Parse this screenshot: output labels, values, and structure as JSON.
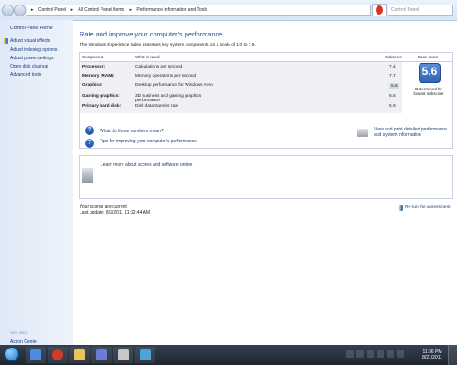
{
  "address": {
    "path": [
      "Control Panel",
      "All Control Panel Items",
      "Performance Information and Tools"
    ],
    "separator": "▸",
    "search_placeholder": "Control Panel"
  },
  "sidebar": {
    "home": "Control Panel Home",
    "links": [
      "Adjust visual effects",
      "Adjust indexing options",
      "Adjust power settings",
      "Open disk cleanup",
      "Advanced tools"
    ],
    "see_also": "See also",
    "action_center": "Action Center"
  },
  "main": {
    "title": "Rate and improve your computer's performance",
    "description": "The Windows Experience Index assesses key system components on a scale of 1.0 to 7.9.",
    "table": {
      "headers": {
        "component": "Component",
        "what": "What is rated",
        "subscore": "Subscore",
        "base": "Base score"
      },
      "rows": [
        {
          "component": "Processor:",
          "what": "Calculations per second",
          "subscore": "7.4"
        },
        {
          "component": "Memory (RAM):",
          "what": "Memory operations per second",
          "subscore": "7.7"
        },
        {
          "component": "Graphics:",
          "what": "Desktop performance for Windows Aero",
          "subscore": "5.6"
        },
        {
          "component": "Gaming graphics:",
          "what": "3D business and gaming graphics performance",
          "subscore": "6.6"
        },
        {
          "component": "Primary hard disk:",
          "what": "Disk data transfer rate",
          "subscore": "5.9"
        }
      ],
      "base_score": "5.6",
      "base_label": "Determined by lowest subscore"
    },
    "links": {
      "help1": "What do these numbers mean?",
      "help2": "Tips for improving your computer's performance.",
      "print": "View and print detailed performance and system information"
    },
    "learn": "Learn more about scores and software online",
    "status": {
      "current": "Your scores are current",
      "last_update": "Last update: 8/2/2011 11:22:44 AM"
    },
    "rerun": "Re-run the assessment"
  },
  "taskbar": {
    "time": "11:36 PM",
    "date": "8/21/2011"
  }
}
